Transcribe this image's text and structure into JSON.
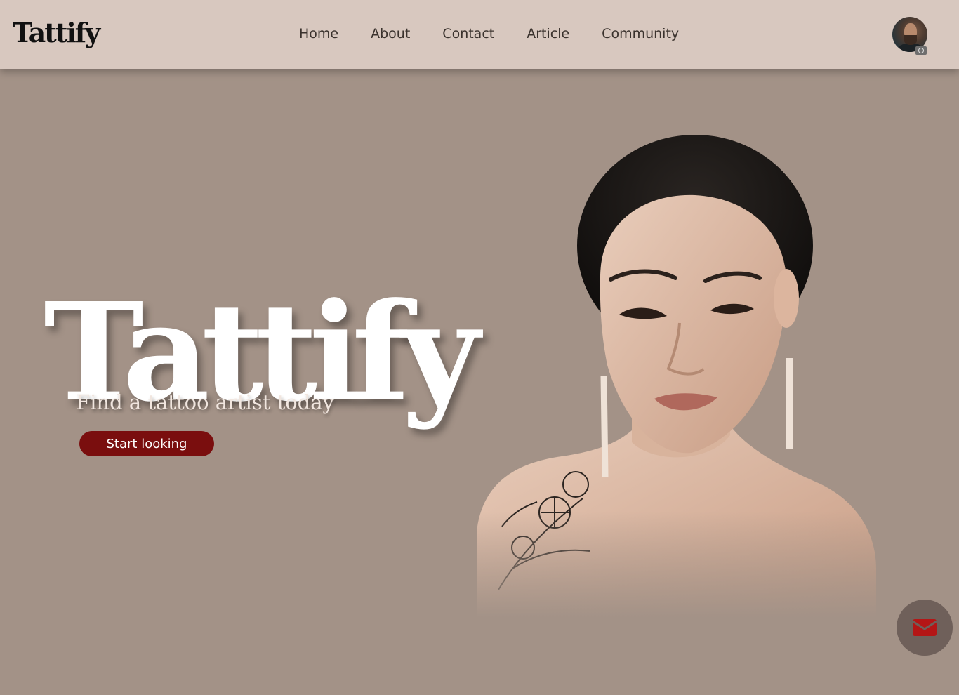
{
  "header": {
    "brand": "Tattify",
    "nav": [
      "Home",
      "About",
      "Contact",
      "Article",
      "Community"
    ],
    "avatar_icon": "user-avatar",
    "camera_icon": "camera-icon"
  },
  "hero": {
    "title": "Tattify",
    "subtitle": "Find a tattoo artist today",
    "cta_label": "Start looking",
    "image": "woman-with-floral-shoulder-tattoo"
  },
  "fab": {
    "icon": "envelope-icon"
  },
  "colors": {
    "background": "#a39287",
    "navbar": "#d8c8bf",
    "cta": "#7a0e0e",
    "fab": "#6f605a",
    "envelope": "#b41616"
  }
}
